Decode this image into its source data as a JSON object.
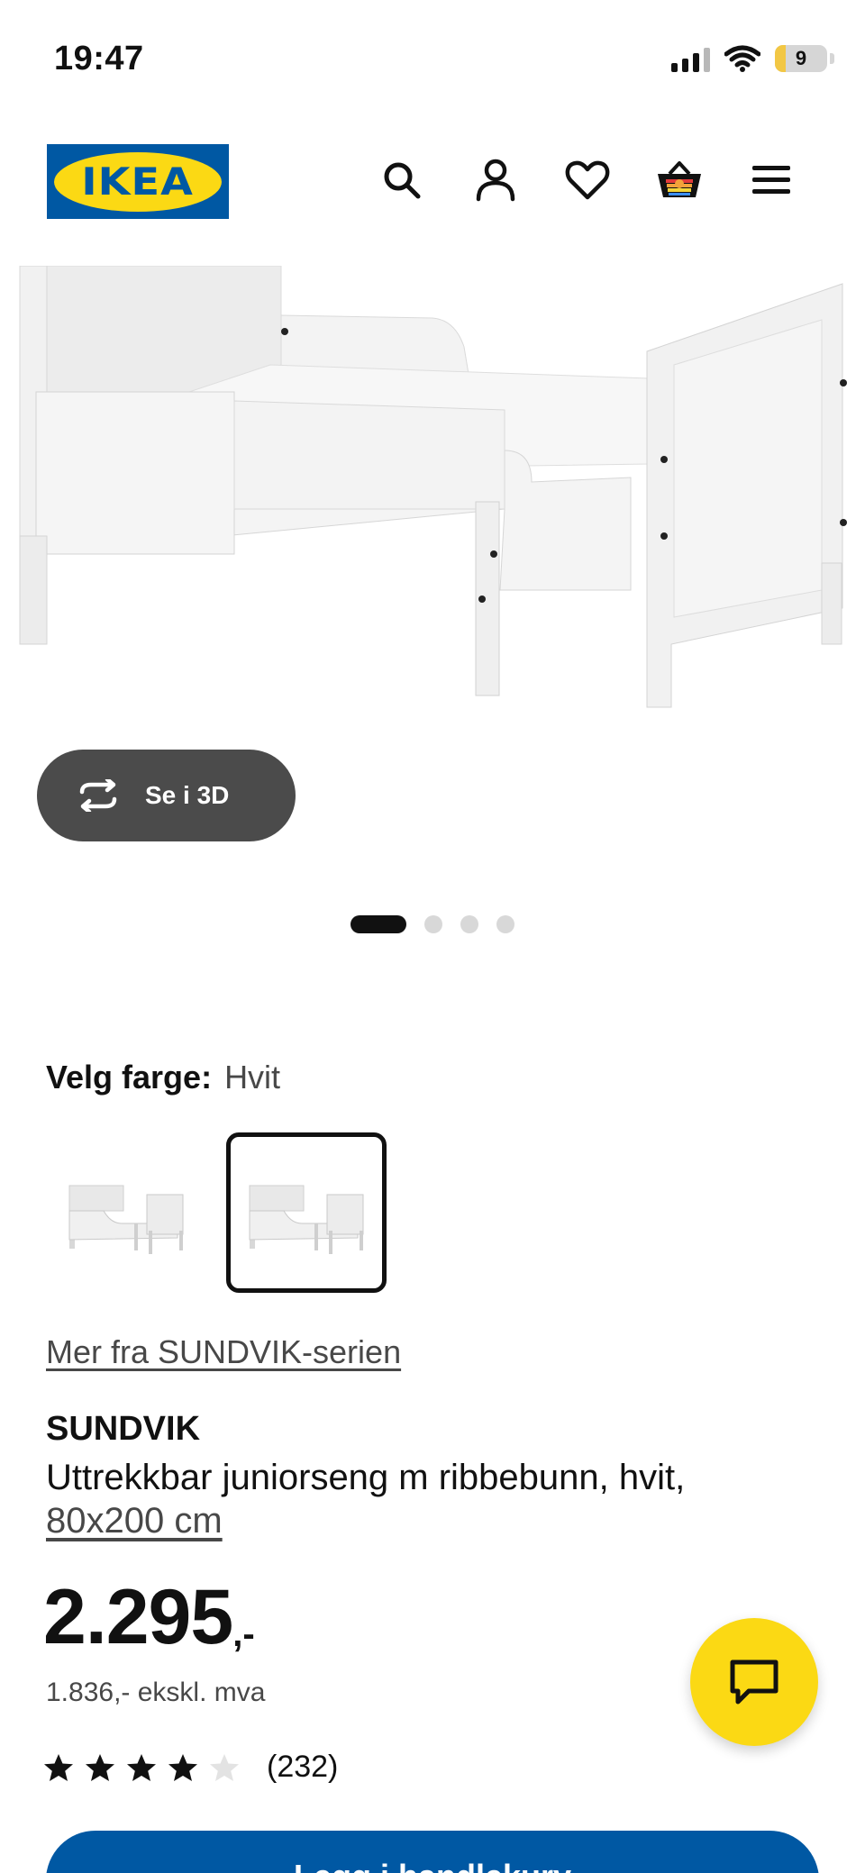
{
  "status_bar": {
    "time": "19:47",
    "battery": "9"
  },
  "header": {
    "logo_text": "IKEA",
    "icons": [
      "search-icon",
      "account-icon",
      "heart-icon",
      "cart-icon",
      "menu-icon"
    ]
  },
  "gallery": {
    "view_3d_label": "Se i 3D",
    "image_count": 4,
    "active_index": 0
  },
  "color": {
    "label": "Velg farge:",
    "value": "Hvit",
    "swatches": [
      {
        "name": "Hvit variant 1",
        "selected": false
      },
      {
        "name": "Hvit",
        "selected": true
      }
    ]
  },
  "series_link": "Mer fra SUNDVIK-serien",
  "product": {
    "name": "SUNDVIK",
    "description": "Uttrekkbar juniorseng m ribbebunn, hvit,",
    "size": "80x200 cm",
    "price": "2.295",
    "price_suffix": ",-",
    "price_ex_vat": "1.836,- ekskl. mva",
    "rating": 4,
    "rating_max": 5,
    "review_count": "(232)"
  },
  "add_to_cart_label": "Legg i handlekurv",
  "colors": {
    "ikea_blue": "#0058a3",
    "ikea_yellow": "#fbd914",
    "dark_button": "#4b4b4b"
  }
}
